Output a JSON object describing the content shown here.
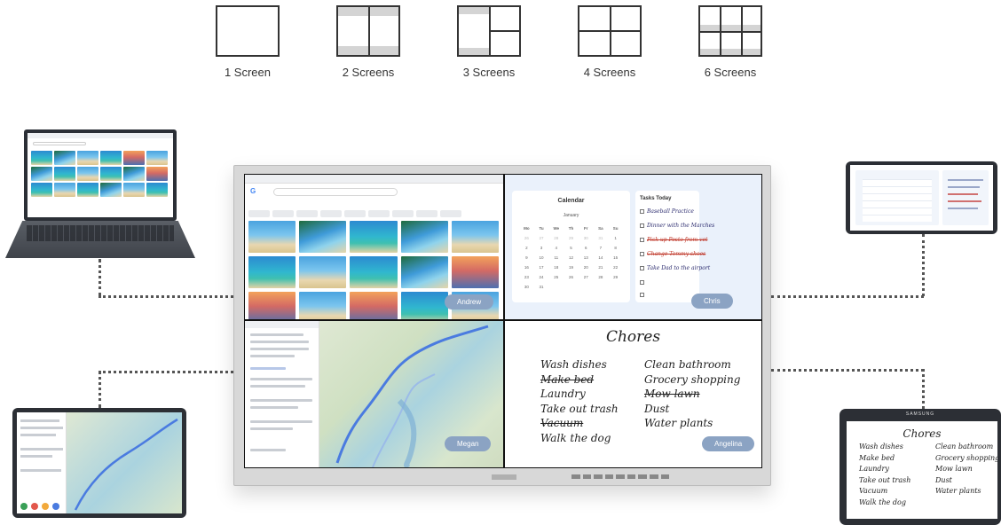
{
  "layouts": [
    {
      "label": "1 Screen"
    },
    {
      "label": "2 Screens"
    },
    {
      "label": "3 Screens"
    },
    {
      "label": "4 Screens"
    },
    {
      "label": "6 Screens"
    }
  ],
  "display": {
    "users": [
      "Andrew",
      "Chris",
      "Megan",
      "Angelina"
    ],
    "calendar": {
      "title": "Calendar",
      "month": "January",
      "weekdays": [
        "Mo",
        "Tu",
        "We",
        "Th",
        "Fr",
        "Sa",
        "Su"
      ],
      "days": [
        "26",
        "27",
        "28",
        "29",
        "30",
        "31",
        "1",
        "2",
        "3",
        "4",
        "5",
        "6",
        "7",
        "8",
        "9",
        "10",
        "11",
        "12",
        "13",
        "14",
        "15",
        "16",
        "17",
        "18",
        "19",
        "20",
        "21",
        "22",
        "23",
        "24",
        "25",
        "26",
        "27",
        "28",
        "29",
        "30",
        "31"
      ]
    },
    "tasks": {
      "title": "Tasks Today",
      "items": [
        {
          "label": "Baseball Practice",
          "done": false
        },
        {
          "label": "Dinner with the Marches",
          "done": false
        },
        {
          "label": "Pick up Pesto from vet",
          "done": true
        },
        {
          "label": "Change Tommy shoes",
          "done": true
        },
        {
          "label": "Take Dad to the airport",
          "done": false
        }
      ]
    },
    "chores": {
      "title": "Chores",
      "left": [
        {
          "label": "Wash dishes",
          "struck": false
        },
        {
          "label": "Make bed",
          "struck": true
        },
        {
          "label": "Laundry",
          "struck": false
        },
        {
          "label": "Take out trash",
          "struck": false
        },
        {
          "label": "Vacuum",
          "struck": true
        },
        {
          "label": "Walk the dog",
          "struck": false
        }
      ],
      "right": [
        {
          "label": "Clean bathroom",
          "struck": false
        },
        {
          "label": "Grocery shopping",
          "struck": false
        },
        {
          "label": "Mow lawn",
          "struck": true
        },
        {
          "label": "Dust",
          "struck": false
        },
        {
          "label": "Water plants",
          "struck": false
        }
      ]
    }
  },
  "tablet_right": {
    "brand": "SAMSUNG",
    "chores_title": "Chores",
    "left": [
      "Wash dishes",
      "Make bed",
      "Laundry",
      "Take out trash",
      "Vacuum",
      "Walk the dog"
    ],
    "right": [
      "Clean bathroom",
      "Grocery shopping",
      "Mow lawn",
      "Dust",
      "Water plants"
    ]
  },
  "icons": {
    "search": "search-icon",
    "map": "map-icon"
  }
}
